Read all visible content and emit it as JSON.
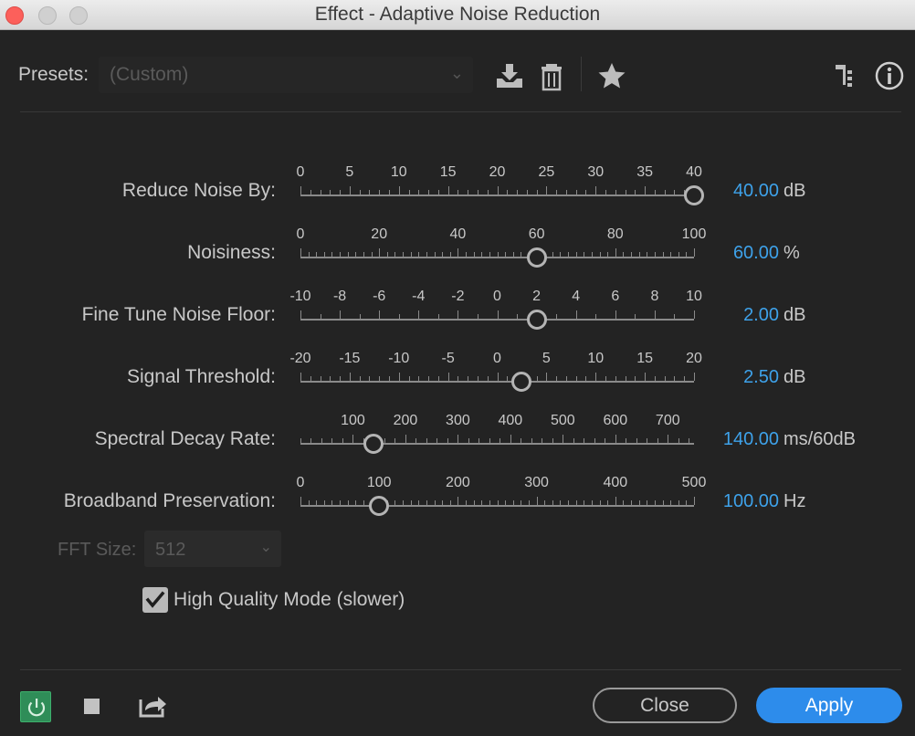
{
  "window": {
    "title": "Effect - Adaptive Noise Reduction"
  },
  "presets": {
    "label": "Presets:",
    "value": "(Custom)",
    "icons": [
      "save-preset-icon",
      "delete-preset-icon",
      "favorite-star-icon",
      "routing-icon",
      "info-icon"
    ]
  },
  "params": [
    {
      "label": "Reduce Noise By:",
      "ticks": [
        "0",
        "5",
        "10",
        "15",
        "20",
        "25",
        "30",
        "35",
        "40"
      ],
      "min": 0,
      "max": 40,
      "value": 40,
      "value_text": "40.00",
      "unit": "dB"
    },
    {
      "label": "Noisiness:",
      "ticks": [
        "0",
        "20",
        "40",
        "60",
        "80",
        "100"
      ],
      "min": 0,
      "max": 100,
      "value": 60,
      "value_text": "60.00",
      "unit": "%"
    },
    {
      "label": "Fine Tune Noise Floor:",
      "ticks": [
        "-10",
        "-8",
        "-6",
        "-4",
        "-2",
        "0",
        "2",
        "4",
        "6",
        "8",
        "10"
      ],
      "min": -10,
      "max": 10,
      "value": 2,
      "value_text": "2.00",
      "unit": "dB"
    },
    {
      "label": "Signal Threshold:",
      "ticks": [
        "-20",
        "-15",
        "-10",
        "-5",
        "0",
        "5",
        "10",
        "15",
        "20"
      ],
      "min": -20,
      "max": 20,
      "value": 2.5,
      "value_text": "2.50",
      "unit": "dB"
    },
    {
      "label": "Spectral Decay Rate:",
      "ticks": [
        "100",
        "200",
        "300",
        "400",
        "500",
        "600",
        "700"
      ],
      "min": 0,
      "max": 750,
      "value": 140,
      "value_text": "140.00",
      "unit": "ms/60dB"
    },
    {
      "label": "Broadband Preservation:",
      "ticks": [
        "0",
        "100",
        "200",
        "300",
        "400",
        "500"
      ],
      "min": 0,
      "max": 500,
      "value": 100,
      "value_text": "100.00",
      "unit": "Hz"
    }
  ],
  "fft": {
    "label": "FFT Size:",
    "value": "512"
  },
  "high_quality": {
    "label": "High Quality Mode (slower)",
    "checked": true
  },
  "buttons": {
    "close": "Close",
    "apply": "Apply"
  },
  "colors": {
    "accent": "#3ea2ea",
    "apply": "#2d8ceb",
    "power": "#2f8d58"
  }
}
